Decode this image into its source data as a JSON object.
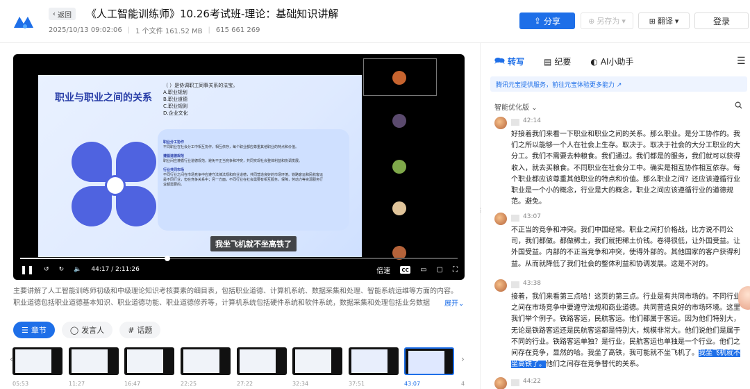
{
  "header": {
    "back_label": "返回",
    "title": "《人工智能训练师》10.26考试班-理论：基础知识讲解",
    "date": "2025/10/13 09:02:06",
    "file_info": "1 个文件 161.52 MB",
    "views": "615 661 269",
    "share_label": "分享",
    "saveas_label": "另存为",
    "translate_label": "翻译",
    "login_label": "登录"
  },
  "video": {
    "slide_title": "职业与职业之间的关系",
    "slide_question": "（   ）是协调职工同事关系的法宝。",
    "slide_options": [
      "A.职业规划",
      "B.职业道德",
      "C.职业规则",
      "D.企业文化"
    ],
    "slide_para1_title": "职业分工协作",
    "slide_para1": "不同职业在社会分工中相互协作，相互依存，每个职业都应尊重其他职业的特点和价值。",
    "slide_para2_title": "遵循道德规范",
    "slide_para2": "职业间应遵循行业道德规范，避免不正当竞争和冲突，共同实现社会整体利益和协调发展。",
    "slide_para3_title": "行业共同市场",
    "slide_para3": "不同行业之间在市场竞争中应遵守法律法规和商业道德，共同营造良好的市场环境。铁路客运和民航客运是不同行业，但在竞争关系中；另一方面，不同行业在社会需要有相互服务，保障，劳动力等资源服务行业都需要的。",
    "subtitle": "我坐飞机就不坐高铁了",
    "time_current": "44:17",
    "time_total": "2:11:26",
    "progress": 0.337,
    "speed_label": "倍速",
    "cc_label": "CC"
  },
  "description": {
    "line1": "主要讲解了人工智能训练师初级和中级理论知识考核要素的细目表，包括职业道德、计算机系统、数据采集和处理、智能系统运维等方面的内容。",
    "line2": "职业道德包括职业道德基本知识、职业道德功能、职业道德修养等，计算机系统包括硬件系统和软件系统，数据采集和处理包括业务数据",
    "more_label": "展开"
  },
  "tabs": [
    {
      "label": "章节",
      "icon": "list-icon"
    },
    {
      "label": "发言人",
      "icon": "person-icon"
    },
    {
      "label": "话题",
      "icon": "hash-icon"
    }
  ],
  "chapters": [
    {
      "time": "05:53"
    },
    {
      "time": "11:27"
    },
    {
      "time": "16:47"
    },
    {
      "time": "22:25"
    },
    {
      "time": "27:22"
    },
    {
      "time": "32:34"
    },
    {
      "time": "37:51"
    },
    {
      "time": "43:07"
    },
    {
      "time": "4"
    }
  ],
  "right_panel": {
    "tabs": [
      {
        "label": "转写",
        "icon": "transcript-icon"
      },
      {
        "label": "纪要",
        "icon": "summary-icon"
      },
      {
        "label": "AI小助手",
        "icon": "ai-icon"
      }
    ],
    "banner": "腾讯元宝提供服务，前往元宝体验更多能力 ↗",
    "smart_label": "智能优化版",
    "entries": [
      {
        "time": "42:14",
        "text": "好接着我们来看一下职业和职业之间的关系。那么职业。是分工协作的。我们之所以能够一个人在社会上生存。取决于。取决于社会的大分工职业的大分工。我们不需要去种粮食。我们通过。我们都是的服务，我们就可以获得收入，就去买粮食。不同职业在社会分工中。确实是相互协作相互依存。每个职业都应该尊重其他职业的特点和价值。那么职业之间？还应该遵循行业职业是一个小的概念，行业是大的概念，职业之间应该遵循行业的道德规范。避免。"
      },
      {
        "time": "43:07",
        "text": "不正当的竞争和冲突。我们中国经常。职业之间打价格战，比方说不同公司，我们都做。都做稀土，我们就把稀土价钱。卷得很低，让外国受益。让外国受益。内部的不正当竞争和冲突，使得外部的。其他国家的客户获得利益。从而就降低了我们社会的整体利益和协调发展。这是不对的。"
      },
      {
        "time": "43:38",
        "text_before": "接着，我们来看第三点哈！这页的第三点。行业是有共同市场的。不同行业之间在市场竞争中要遵守法规和商业道德。共同营造良好的市场环境。这里我们举个例子。铁路客运，民航客运。他们都属于客运。因为他们特别大，无论是铁路客运还是民航客运都是特别大，规模非常大。他们说他们是属于不同的行业。铁路客运单独？是行业，民航客运也单独是一个行业。他们之间存在竞争，显然的哈。我坐了高铁，我可能就不坐飞机了。",
        "text_highlight": "我坐飞机就不坐高铁了。",
        "text_after": "他们之间存在竞争替代的关系。"
      },
      {
        "time": "44:22",
        "text": ""
      }
    ]
  }
}
